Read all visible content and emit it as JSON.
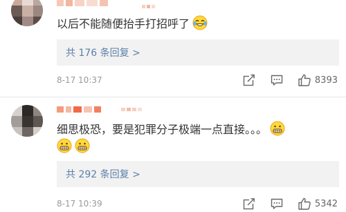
{
  "comments": [
    {
      "text": "以后不能随便抬手打招呼了",
      "reply_label": "共 176 条回复 >",
      "timestamp": "8-17 10:37",
      "likes": "8393",
      "text_emoji": "laughing-crying-emoji"
    },
    {
      "text": "细思极恐，要是犯罪分子极端一点直接。。。",
      "reply_label": "共 292 条回复 >",
      "timestamp": "8-17 10:39",
      "likes": "5342",
      "text_emoji": "grimace-emoji"
    }
  ],
  "icons": {
    "share": "share-icon",
    "comment": "comment-icon",
    "like": "thumbs-up-icon"
  },
  "colors": {
    "link": "#5b7fa8",
    "meta": "#999999",
    "reply_bg": "#f2f2f2",
    "name_blur_red": "#f06a4a"
  }
}
